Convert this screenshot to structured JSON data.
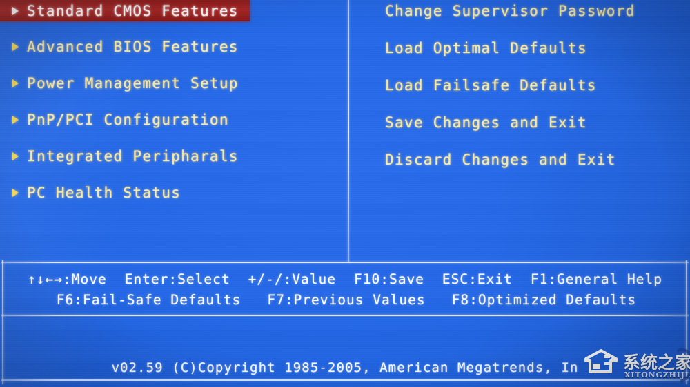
{
  "theme": {
    "background_color": "#1e5fd8",
    "menu_text_color": "#f7eaa8",
    "selected_bg_color": "#a82424",
    "selected_text_color": "#ffffff",
    "help_text_color": "#ffffff",
    "arrow_color": "#f3d552",
    "divider_color": "#e8f0ff"
  },
  "menu": {
    "left_column": [
      {
        "label": "Standard CMOS Features",
        "selected": true,
        "marker": "right-triangle-icon"
      },
      {
        "label": "Advanced BIOS Features",
        "selected": false,
        "marker": "right-triangle-icon"
      },
      {
        "label": "Power Management Setup",
        "selected": false,
        "marker": "right-triangle-icon"
      },
      {
        "label": "PnP/PCI Configuration",
        "selected": false,
        "marker": "right-triangle-icon"
      },
      {
        "label": "Integrated Peripharals",
        "selected": false,
        "marker": "right-triangle-icon"
      },
      {
        "label": "PC Health Status",
        "selected": false,
        "marker": "right-triangle-icon"
      }
    ],
    "right_column": [
      {
        "label": "Change Supervisor Password",
        "selected": false
      },
      {
        "label": "Load Optimal Defaults",
        "selected": false
      },
      {
        "label": "Load Failsafe Defaults",
        "selected": false
      },
      {
        "label": "Save Changes and Exit",
        "selected": false
      },
      {
        "label": "Discard Changes and Exit",
        "selected": false
      }
    ]
  },
  "help_bar": {
    "row_1": [
      "↑↓←→:Move",
      "Enter:Select",
      "+/-/:Value",
      "F10:Save",
      "ESC:Exit",
      "F1:General Help"
    ],
    "row_2": [
      "F6:Fail-Safe Defaults",
      "F7:Previous Values",
      "F8:Optimized Defaults"
    ]
  },
  "footer": {
    "copyright": "v02.59 (C)Copyright 1985-2005, American Megatrends, In"
  },
  "watermark": {
    "chinese": "系统之家",
    "domain": "XITONGZHIJIA.NET"
  }
}
